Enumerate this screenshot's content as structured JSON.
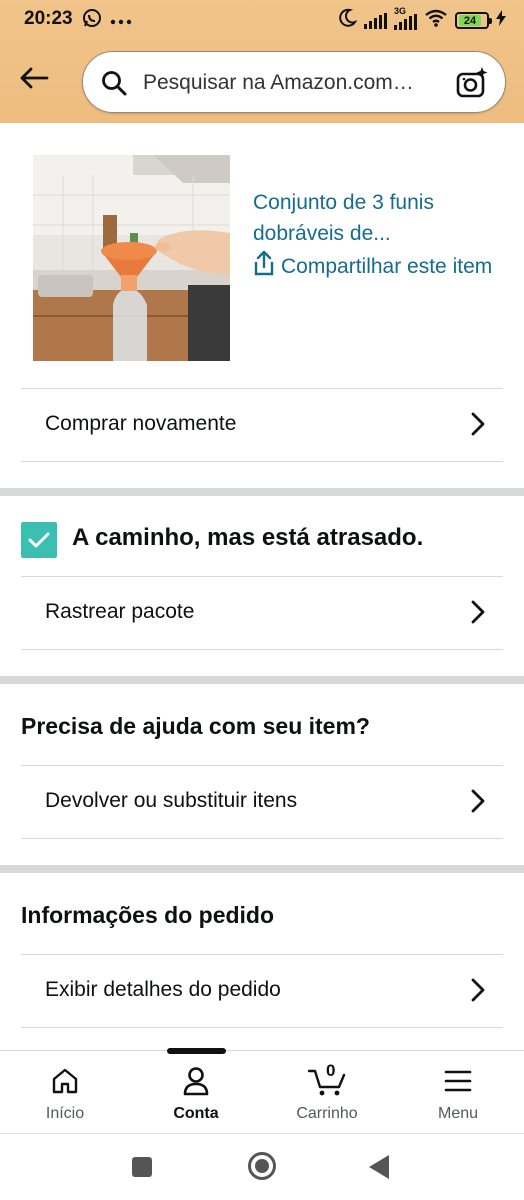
{
  "status_bar": {
    "time": "20:23",
    "network_label": "3G",
    "battery_level": "24",
    "icons": [
      "whatsapp-icon",
      "more-dots-icon",
      "moon-icon",
      "signal-icon",
      "wifi-icon",
      "battery-icon",
      "charging-icon"
    ]
  },
  "header": {
    "back_icon": "arrow-left-icon",
    "search_placeholder": "Pesquisar na Amazon.com…",
    "camera_icon": "camera-sparkle-icon",
    "background_color": "#efc183"
  },
  "product": {
    "title": "Conjunto de 3 funis dobráveis de...",
    "share_label": "Compartilhar este item",
    "image_icon": "product-photo-funnel"
  },
  "rows": {
    "buy_again": "Comprar novamente",
    "track_package": "Rastrear pacote",
    "return_replace": "Devolver ou substituir itens",
    "order_details": "Exibir detalhes do pedido"
  },
  "delivery_status": {
    "text": "A caminho, mas está atrasado.",
    "check_color": "#3bbfb3"
  },
  "sections": {
    "help_heading": "Precisa de ajuda com seu item?",
    "order_info_heading": "Informações do pedido"
  },
  "bottom_nav": {
    "items": [
      {
        "label": "Início",
        "icon": "home-icon",
        "active": false
      },
      {
        "label": "Conta",
        "icon": "person-icon",
        "active": true
      },
      {
        "label": "Carrinho",
        "icon": "cart-icon",
        "active": false,
        "count": "0"
      },
      {
        "label": "Menu",
        "icon": "hamburger-icon",
        "active": false
      }
    ]
  },
  "colors": {
    "link": "#146c8f",
    "divider": "#d5d9d9",
    "text": "#0f1111"
  }
}
